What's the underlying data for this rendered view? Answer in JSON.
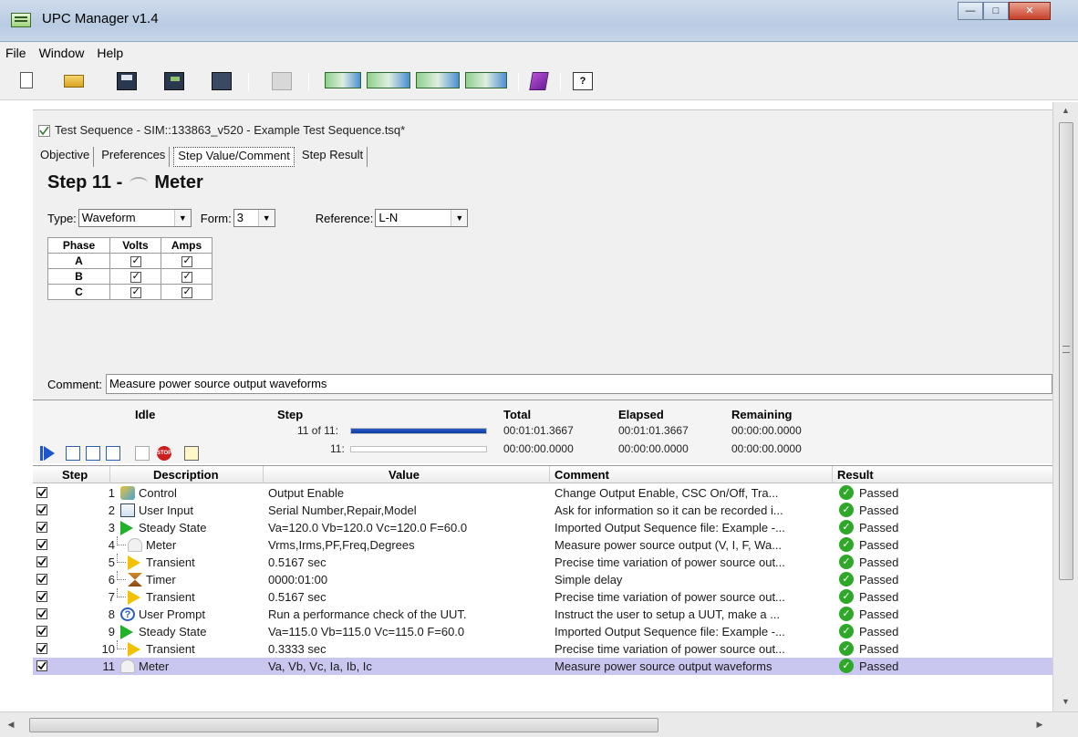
{
  "window": {
    "title": "UPC Manager v1.4",
    "controls": [
      "minimize",
      "maximize",
      "close"
    ]
  },
  "menu": [
    "File",
    "Window",
    "Help"
  ],
  "toolbar_icons": [
    "new-icon",
    "open-folder-icon",
    "save-icon",
    "save-all-icon",
    "save-as-icon",
    "print-icon",
    "import-flow-icon",
    "transfer-to-device-icon",
    "transfer-all-icon",
    "transfer-from-device-icon",
    "manual-book-icon",
    "help-icon"
  ],
  "sequence": {
    "title": "Test Sequence - SIM::133863_v520 - Example Test Sequence.tsq*",
    "tabs": [
      "Objective",
      "Preferences",
      "Step Value/Comment",
      "Step Result"
    ],
    "active_tab": "Step Value/Comment",
    "step_heading_prefix": "Step 11 -",
    "step_heading_name": "Meter",
    "type_label": "Type:",
    "type_value": "Waveform",
    "form_label": "Form:",
    "form_value": "3",
    "reference_label": "Reference:",
    "reference_value": "L-N",
    "phase_table": {
      "headers": [
        "Phase",
        "Volts",
        "Amps"
      ],
      "rows": [
        {
          "phase": "A",
          "volts": true,
          "amps": true
        },
        {
          "phase": "B",
          "volts": true,
          "amps": true
        },
        {
          "phase": "C",
          "volts": true,
          "amps": true
        }
      ]
    },
    "comment_label": "Comment:",
    "comment_value": "Measure power source output waveforms"
  },
  "status": {
    "state": "Idle",
    "step_label": "Step",
    "total_label": "Total",
    "elapsed_label": "Elapsed",
    "remaining_label": "Remaining",
    "row1": {
      "step": "11 of 11:",
      "total": "00:01:01.3667",
      "elapsed": "00:01:01.3667",
      "remaining": "00:00:00.0000",
      "progress": 1.0
    },
    "row2": {
      "step": "11:",
      "total": "00:00:00.0000",
      "elapsed": "00:00:00.0000",
      "remaining": "00:00:00.0000",
      "progress": 0.0
    }
  },
  "steps_table": {
    "headers": {
      "step": "Step",
      "description": "Description",
      "value": "Value",
      "comment": "Comment",
      "result": "Result"
    },
    "rows": [
      {
        "num": "1",
        "icon": "control-icon",
        "desc": "Control",
        "value": "Output Enable",
        "comment": "Change Output Enable, CSC On/Off, Tra...",
        "result": "Passed"
      },
      {
        "num": "2",
        "icon": "user-input-icon",
        "desc": "User Input",
        "value": "Serial Number,Repair,Model",
        "comment": "Ask for information so it can be recorded i...",
        "result": "Passed"
      },
      {
        "num": "3",
        "icon": "steady-state-icon",
        "desc": "Steady State",
        "value": "Va=120.0 Vb=120.0 Vc=120.0 F=60.0",
        "comment": "Imported Output Sequence file: Example -...",
        "result": "Passed"
      },
      {
        "num": "4",
        "icon": "meter-icon",
        "desc": "Meter",
        "value": "Vrms,Irms,PF,Freq,Degrees",
        "comment": "Measure power source output (V, I, F, Wa...",
        "result": "Passed"
      },
      {
        "num": "5",
        "icon": "transient-icon",
        "desc": "Transient",
        "value": "0.5167 sec",
        "comment": "Precise time variation of power source out...",
        "result": "Passed"
      },
      {
        "num": "6",
        "icon": "timer-icon",
        "desc": "Timer",
        "value": "0000:01:00",
        "comment": "Simple delay",
        "result": "Passed"
      },
      {
        "num": "7",
        "icon": "transient-icon",
        "desc": "Transient",
        "value": "0.5167 sec",
        "comment": "Precise time variation of power source out...",
        "result": "Passed"
      },
      {
        "num": "8",
        "icon": "user-prompt-icon",
        "desc": "User Prompt",
        "value": "Run a performance check of the UUT.",
        "comment": "Instruct the user to setup a UUT, make a ...",
        "result": "Passed"
      },
      {
        "num": "9",
        "icon": "steady-state-icon",
        "desc": "Steady State",
        "value": "Va=115.0 Vb=115.0 Vc=115.0 F=60.0",
        "comment": "Imported Output Sequence file: Example -...",
        "result": "Passed"
      },
      {
        "num": "10",
        "icon": "transient-icon",
        "desc": "Transient",
        "value": "0.3333 sec",
        "comment": "Precise time variation of power source out...",
        "result": "Passed"
      },
      {
        "num": "11",
        "icon": "meter-icon",
        "desc": "Meter",
        "value": "Va, Vb, Vc, Ia, Ib, Ic",
        "comment": "Measure power source output waveforms",
        "result": "Passed"
      }
    ]
  },
  "selected_row": "11"
}
